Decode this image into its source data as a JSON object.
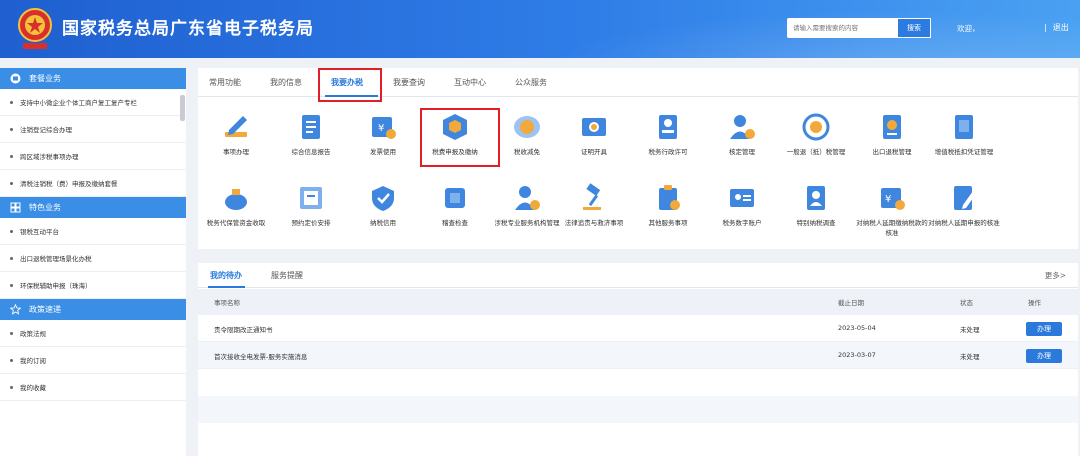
{
  "header": {
    "title": "国家税务总局广东省电子税务局",
    "emblem_caption": "中国税务",
    "search_placeholder": "请输入需要搜索的内容",
    "search_label": "搜索",
    "welcome": "欢迎，",
    "separator": "|",
    "logout": "退出",
    "colors": {
      "bar_start": "#1f5fd0",
      "bar_end": "#4aa1f2"
    }
  },
  "sidebar": {
    "sections": [
      {
        "title": "套餐业务",
        "icon": "package-icon",
        "items": [
          "支持中小微企业个体工商户复工复产专栏",
          "注销登记综合办理",
          "跨区域涉税事项办理",
          "清税注销税（费）申报及缴纳套餐"
        ]
      },
      {
        "title": "特色业务",
        "icon": "grid-icon",
        "items": [
          "银税互动平台",
          "出口退税管理场景化办税",
          "环保税辅助申报（珠海）"
        ]
      },
      {
        "title": "政策速递",
        "icon": "star-icon",
        "items": [
          "政策法规",
          "我的订阅",
          "我的收藏"
        ]
      }
    ],
    "colors": {
      "section_bg": "#3a8ee6"
    }
  },
  "tabs": [
    "常用功能",
    "我的信息",
    "我要办税",
    "我要查询",
    "互动中心",
    "公众服务"
  ],
  "active_tab": "我要办税",
  "services": [
    {
      "label": "事项办理",
      "icon": "pencil-icon"
    },
    {
      "label": "综合信息报告",
      "icon": "report-icon"
    },
    {
      "label": "发票使用",
      "icon": "invoice-icon"
    },
    {
      "label": "税费申报及缴纳",
      "icon": "tax-declare-icon"
    },
    {
      "label": "税收减免",
      "icon": "coins-icon"
    },
    {
      "label": "证明开具",
      "icon": "certificate-icon"
    },
    {
      "label": "税务行政许可",
      "icon": "permit-icon"
    },
    {
      "label": "核定管理",
      "icon": "user-gear-icon"
    },
    {
      "label": "一般退（抵）税管理",
      "icon": "refund-icon"
    },
    {
      "label": "出口退税管理",
      "icon": "export-refund-icon"
    },
    {
      "label": "增值税抵扣凭证管理",
      "icon": "voucher-icon"
    },
    {
      "label": "税务代保管资金收取",
      "icon": "money-bag-icon"
    },
    {
      "label": "预约定价安排",
      "icon": "pricing-icon"
    },
    {
      "label": "纳税信用",
      "icon": "shield-check-icon"
    },
    {
      "label": "稽查检查",
      "icon": "audit-icon"
    },
    {
      "label": "涉税专业服务机构管理",
      "icon": "agent-gear-icon"
    },
    {
      "label": "法律追责与救济事项",
      "icon": "gavel-icon"
    },
    {
      "label": "其他服务事项",
      "icon": "clipboard-icon"
    },
    {
      "label": "税务数字账户",
      "icon": "id-card-icon"
    },
    {
      "label": "特别纳税调查",
      "icon": "person-doc-icon"
    },
    {
      "label": "对纳税人延期缴纳税款的核准",
      "icon": "defer-payment-icon"
    },
    {
      "label": "对纳税人延期申报的核准",
      "icon": "defer-declare-icon"
    }
  ],
  "todo": {
    "tab_mine": "我的待办",
    "tab_remind": "服务提醒",
    "more": "更多>",
    "columns": [
      "事项名称",
      "截止日期",
      "状态",
      "操作"
    ],
    "rows": [
      {
        "name": "责令限期改正通知书",
        "date": "2023-05-04",
        "status": "未处理",
        "action": "办理"
      },
      {
        "name": "首次接收全电发票-服务实施消息",
        "date": "2023-03-07",
        "status": "未处理",
        "action": "办理"
      }
    ]
  },
  "colors": {
    "accent": "#2a79db",
    "highlight_box": "#e01f27",
    "icon_blue": "#3f86df",
    "icon_gold": "#f0a93a"
  }
}
